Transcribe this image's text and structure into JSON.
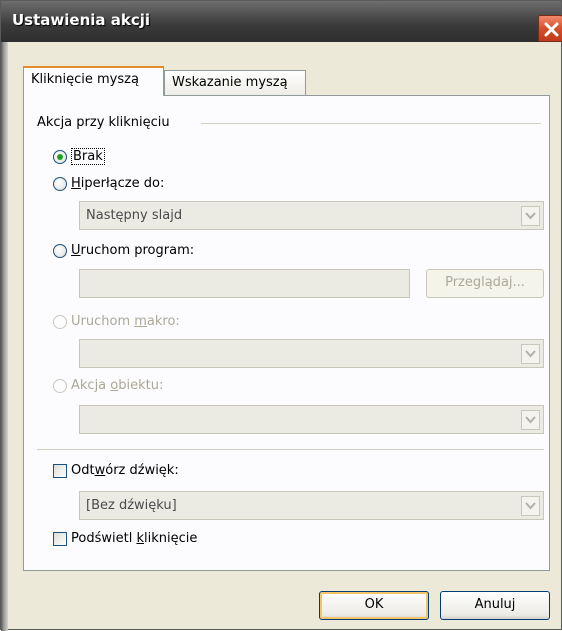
{
  "window": {
    "title": "Ustawienia akcji"
  },
  "tabs": [
    {
      "label": "Kliknięcie myszą",
      "active": true
    },
    {
      "label": "Wskazanie myszą",
      "active": false
    }
  ],
  "group": {
    "label": "Akcja przy kliknięciu"
  },
  "options": {
    "none": {
      "label": "Brak",
      "checked": true
    },
    "hyperlink": {
      "prefix": "",
      "key": "H",
      "rest": "iperłącze do:",
      "value": "Następny slajd"
    },
    "run_program": {
      "prefix": "",
      "key": "U",
      "rest": "ruchom program:",
      "browse_label": "Przeglądaj..."
    },
    "run_macro": {
      "prefix": "Uruchom ",
      "key": "m",
      "rest": "akro:"
    },
    "object_action": {
      "prefix": "Akcja ",
      "key": "o",
      "rest": "biektu:"
    }
  },
  "sound": {
    "prefix": "Odt",
    "key": "w",
    "rest": "órz dźwięk:",
    "value": "[Bez dźwięku]"
  },
  "highlight": {
    "prefix": "Podświetl ",
    "key": "k",
    "rest": "liknięcie"
  },
  "buttons": {
    "ok": "OK",
    "cancel": "Anuluj"
  }
}
